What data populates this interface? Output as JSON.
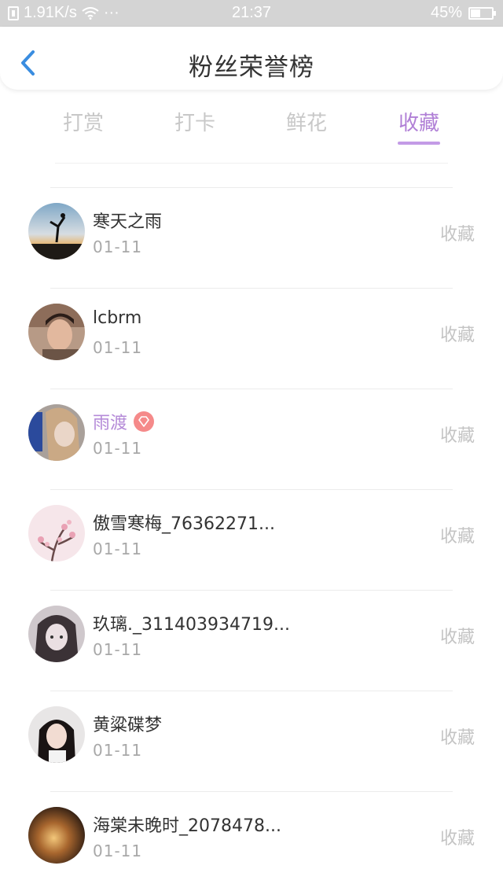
{
  "status_bar": {
    "speed": "1.91K/s",
    "dots": "···",
    "time": "21:37",
    "battery": "45%",
    "battery_level": 0.45
  },
  "header": {
    "title": "粉丝荣誉榜"
  },
  "tabs": [
    {
      "label": "打赏",
      "active": false
    },
    {
      "label": "打卡",
      "active": false
    },
    {
      "label": "鲜花",
      "active": false
    },
    {
      "label": "收藏",
      "active": true
    }
  ],
  "colors": {
    "accent": "#b58bd8",
    "badge": "#f58a8a",
    "inactive": "#c8c8c8"
  },
  "list": [
    {
      "name": "寒天之雨",
      "date": "01-11",
      "action": "收藏",
      "vip": false
    },
    {
      "name": "lcbrm",
      "date": "01-11",
      "action": "收藏",
      "vip": false
    },
    {
      "name": "雨渡",
      "date": "01-11",
      "action": "收藏",
      "vip": true,
      "badge_icon": "diamond-icon"
    },
    {
      "name": "傲雪寒梅_76362271...",
      "date": "01-11",
      "action": "收藏",
      "vip": false
    },
    {
      "name": "玖璃._311403934719...",
      "date": "01-11",
      "action": "收藏",
      "vip": false
    },
    {
      "name": "黄粱碟梦",
      "date": "01-11",
      "action": "收藏",
      "vip": false
    },
    {
      "name": "海棠未晚时_2078478...",
      "date": "01-11",
      "action": "收藏",
      "vip": false
    }
  ]
}
